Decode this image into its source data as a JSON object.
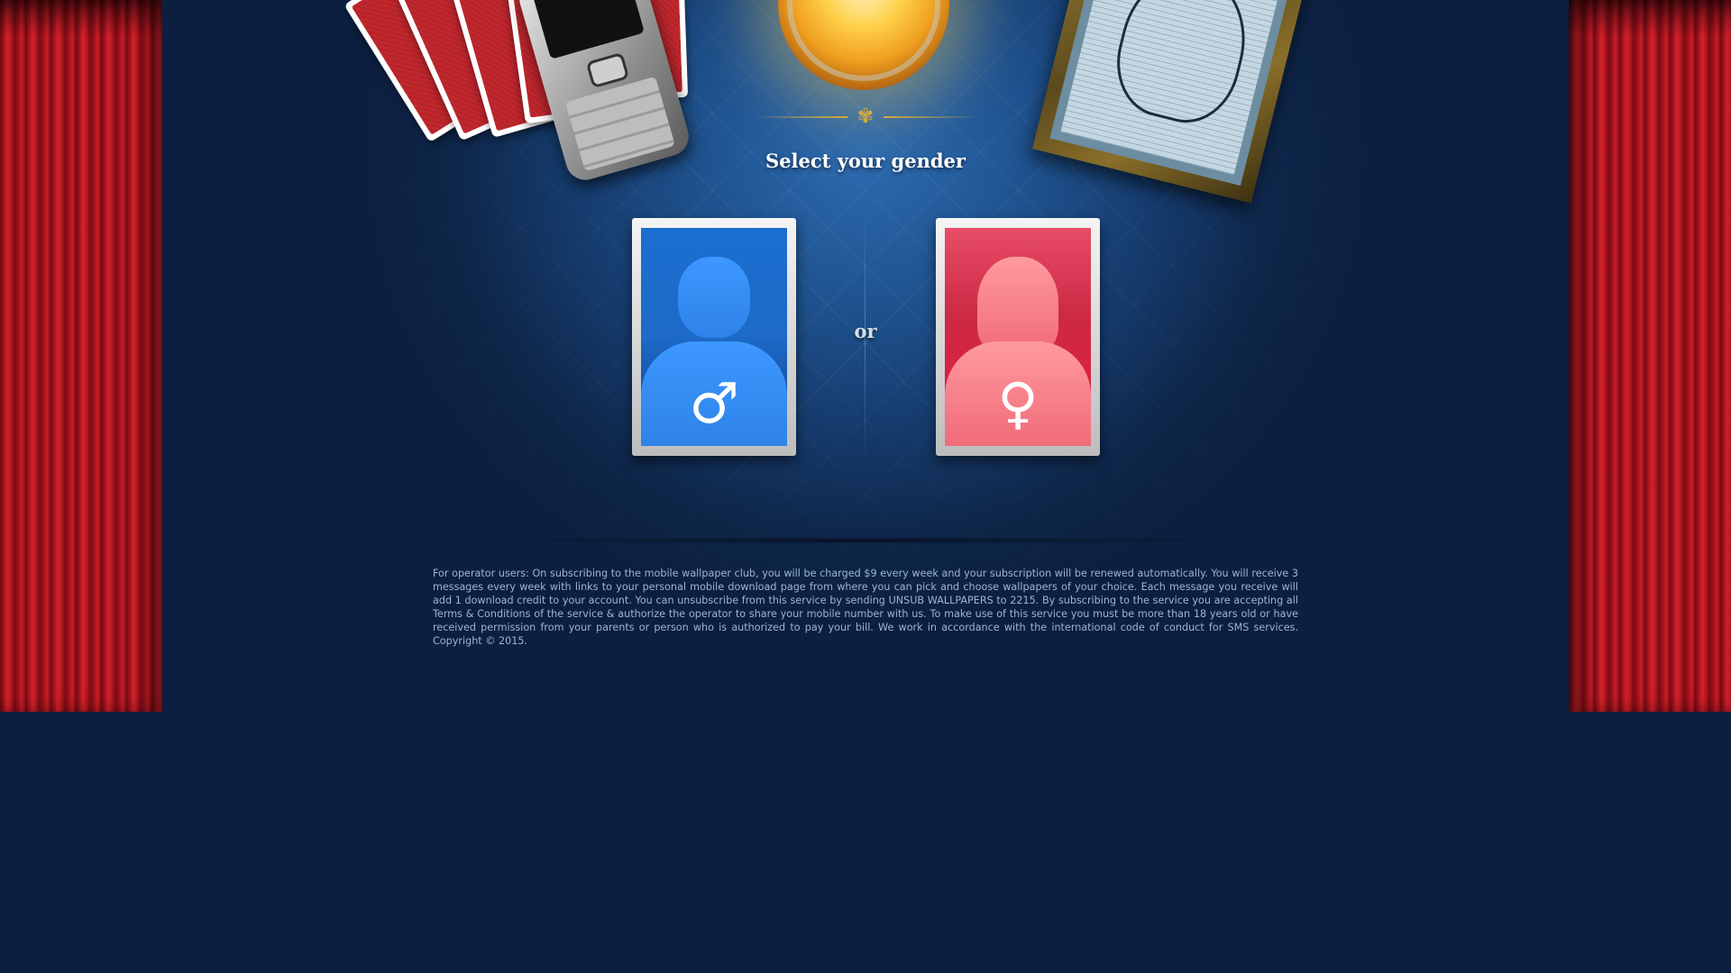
{
  "page": {
    "title": "Select your gender",
    "or_label": "or"
  },
  "options": {
    "male": {
      "symbol": "♂",
      "icon": "male-symbol-icon",
      "color": "#1b6fd0"
    },
    "female": {
      "symbol": "♀",
      "icon": "female-symbol-icon",
      "color": "#e81a3c"
    }
  },
  "decor": {
    "ornament_glyph": "✾",
    "curtain_color": "#c0141e",
    "stage_color": "#0c1f40"
  },
  "disclaimer": "For operator users: On subscribing to the mobile wallpaper club, you will be charged $9 every week and your subscription will be renewed automatically. You will receive 3 messages every week with links to your personal mobile download page from where you can pick and choose wallpapers of your choice. Each message you receive will add 1 download credit to your account. You can unsubscribe from this service by sending UNSUB WALLPAPERS to 2215. By subscribing to the service you are accepting all Terms & Conditions of the service & authorize the operator to share your mobile number with us. To make use of this service you must be more than 18 years old or have received permission from your parents or person who is authorized to pay your bill. We work in accordance with the international code of conduct for SMS services. Copyright © 2015."
}
